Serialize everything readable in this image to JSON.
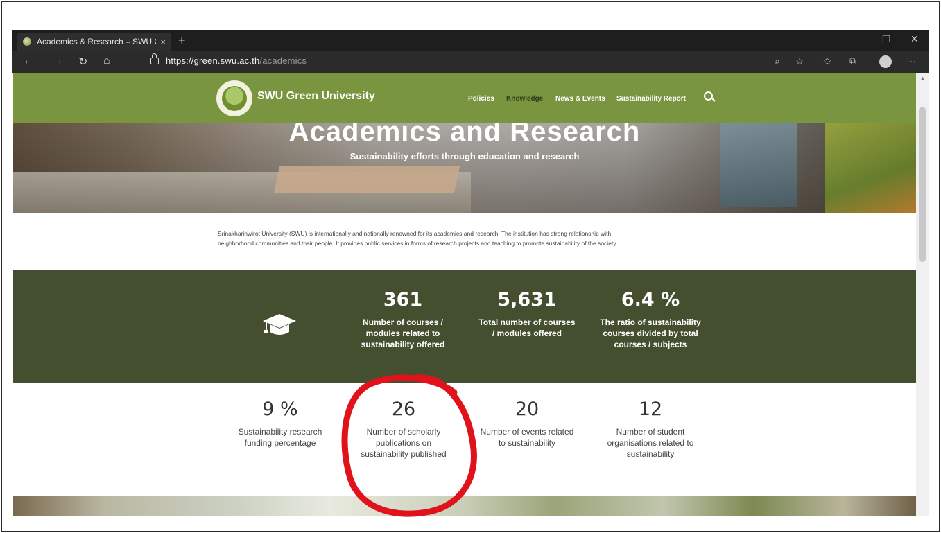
{
  "browser": {
    "tab_title": "Academics & Research – SWU G",
    "tab_close": "×",
    "new_tab": "+",
    "url_host": "https://green.swu.ac.th",
    "url_path": "/academics",
    "window_controls": {
      "minimize": "–",
      "restore": "❐",
      "close": "✕"
    },
    "nav": {
      "back": "←",
      "forward": "→",
      "refresh": "↻",
      "home": "⌂"
    },
    "toolbar": {
      "zoom": "⌕",
      "favorite": "☆",
      "favorites": "✩",
      "collections": "⧉",
      "more": "···"
    }
  },
  "site": {
    "brand": "SWU Green University",
    "menu": [
      {
        "label": "Policies",
        "active": false
      },
      {
        "label": "Knowledge",
        "active": true
      },
      {
        "label": "News & Events",
        "active": false
      },
      {
        "label": "Sustainability Report",
        "active": false
      }
    ]
  },
  "hero": {
    "title": "Academics and Research",
    "subtitle": "Sustainability efforts through education and research"
  },
  "intro": {
    "line1": "Srinakharinwirot University (SWU) is internationally and nationally renowned for its academics and research. The institution has strong relationship with",
    "line2": "neighborhood communities and their people. It provides public services in forms of research projects and teaching to promote sustainability of the society."
  },
  "stats_primary": [
    {
      "value": "361",
      "label": "Number of courses / modules related to sustainability offered"
    },
    {
      "value": "5,631",
      "label": "Total number of courses / modules offered"
    },
    {
      "value": "6.4 %",
      "label": "The ratio of sustainability courses divided by total courses / subjects"
    }
  ],
  "stats_secondary": [
    {
      "value": "9 %",
      "label": "Sustainability research funding percentage"
    },
    {
      "value": "26",
      "label": "Number of scholarly publications on sustainability published"
    },
    {
      "value": "20",
      "label": "Number of events related to sustainability"
    },
    {
      "value": "12",
      "label": "Number of student organisations related to sustainability"
    }
  ],
  "colors": {
    "header_green": "#7a9540",
    "stats_dark": "#444f2f",
    "annotation_red": "#e0121b"
  },
  "icons": {
    "graduation": "graduation-cap-icon",
    "search": "search-icon"
  }
}
